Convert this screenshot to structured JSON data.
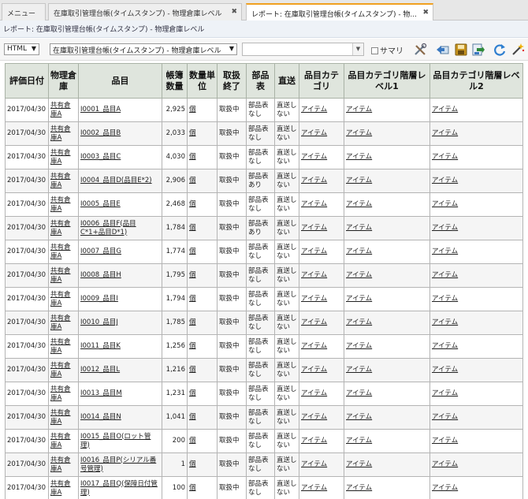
{
  "tabs": [
    {
      "label": "メニュー"
    },
    {
      "label": "在庫取引管理台帳(タイムスタンプ) - 物理倉庫レベル",
      "close": "✖"
    },
    {
      "label": "レポート: 在庫取引管理台帳(タイムスタンプ) - 物...",
      "close": "✖"
    }
  ],
  "breadcrumb": "レポート: 在庫取引管理台帳(タイムスタンプ) - 物理倉庫レベル",
  "toolbar": {
    "format_value": "HTML",
    "report_value": "在庫取引管理台帳(タイムスタンプ) - 物理倉庫レベル",
    "search_value": "",
    "summary_label": "サマリ",
    "icons": [
      "tools-icon",
      "back-icon",
      "save-icon",
      "export-icon",
      "refresh-icon",
      "magic-wand-icon"
    ]
  },
  "table": {
    "headers": [
      "評価日付",
      "物理倉庫",
      "品目",
      "帳簿数量",
      "数量単位",
      "取扱終了",
      "部品表",
      "直送",
      "品目カテゴリ",
      "品目カテゴリ階層レベル1",
      "品目カテゴリ階層レベル2"
    ],
    "rows": [
      {
        "date": "2017/04/30",
        "warehouse": "共有倉庫A",
        "item": "I0001_品目A",
        "qty": "2,925",
        "unit": "個",
        "status": "取扱中",
        "bom": "部品表なし",
        "direct": "直送しない",
        "cat": "アイテム",
        "cat1": "アイテム",
        "cat2": "アイテム"
      },
      {
        "date": "2017/04/30",
        "warehouse": "共有倉庫A",
        "item": "I0002_品目B",
        "qty": "2,033",
        "unit": "個",
        "status": "取扱中",
        "bom": "部品表なし",
        "direct": "直送しない",
        "cat": "アイテム",
        "cat1": "アイテム",
        "cat2": "アイテム"
      },
      {
        "date": "2017/04/30",
        "warehouse": "共有倉庫A",
        "item": "I0003_品目C",
        "qty": "4,030",
        "unit": "個",
        "status": "取扱中",
        "bom": "部品表なし",
        "direct": "直送しない",
        "cat": "アイテム",
        "cat1": "アイテム",
        "cat2": "アイテム"
      },
      {
        "date": "2017/04/30",
        "warehouse": "共有倉庫A",
        "item": "I0004_品目D(品目E*2)",
        "qty": "2,906",
        "unit": "個",
        "status": "取扱中",
        "bom": "部品表あり",
        "direct": "直送しない",
        "cat": "アイテム",
        "cat1": "アイテム",
        "cat2": "アイテム"
      },
      {
        "date": "2017/04/30",
        "warehouse": "共有倉庫A",
        "item": "I0005_品目E",
        "qty": "2,468",
        "unit": "個",
        "status": "取扱中",
        "bom": "部品表なし",
        "direct": "直送しない",
        "cat": "アイテム",
        "cat1": "アイテム",
        "cat2": "アイテム"
      },
      {
        "date": "2017/04/30",
        "warehouse": "共有倉庫A",
        "item": "I0006_品目F(品目C*1+品目D*1)",
        "qty": "1,784",
        "unit": "個",
        "status": "取扱中",
        "bom": "部品表あり",
        "direct": "直送しない",
        "cat": "アイテム",
        "cat1": "アイテム",
        "cat2": "アイテム"
      },
      {
        "date": "2017/04/30",
        "warehouse": "共有倉庫A",
        "item": "I0007_品目G",
        "qty": "1,774",
        "unit": "個",
        "status": "取扱中",
        "bom": "部品表なし",
        "direct": "直送しない",
        "cat": "アイテム",
        "cat1": "アイテム",
        "cat2": "アイテム"
      },
      {
        "date": "2017/04/30",
        "warehouse": "共有倉庫A",
        "item": "I0008_品目H",
        "qty": "1,795",
        "unit": "個",
        "status": "取扱中",
        "bom": "部品表なし",
        "direct": "直送しない",
        "cat": "アイテム",
        "cat1": "アイテム",
        "cat2": "アイテム"
      },
      {
        "date": "2017/04/30",
        "warehouse": "共有倉庫A",
        "item": "I0009_品目I",
        "qty": "1,794",
        "unit": "個",
        "status": "取扱中",
        "bom": "部品表なし",
        "direct": "直送しない",
        "cat": "アイテム",
        "cat1": "アイテム",
        "cat2": "アイテム"
      },
      {
        "date": "2017/04/30",
        "warehouse": "共有倉庫A",
        "item": "I0010_品目J",
        "qty": "1,785",
        "unit": "個",
        "status": "取扱中",
        "bom": "部品表なし",
        "direct": "直送しない",
        "cat": "アイテム",
        "cat1": "アイテム",
        "cat2": "アイテム"
      },
      {
        "date": "2017/04/30",
        "warehouse": "共有倉庫A",
        "item": "I0011_品目K",
        "qty": "1,256",
        "unit": "個",
        "status": "取扱中",
        "bom": "部品表なし",
        "direct": "直送しない",
        "cat": "アイテム",
        "cat1": "アイテム",
        "cat2": "アイテム"
      },
      {
        "date": "2017/04/30",
        "warehouse": "共有倉庫A",
        "item": "I0012_品目L",
        "qty": "1,216",
        "unit": "個",
        "status": "取扱中",
        "bom": "部品表なし",
        "direct": "直送しない",
        "cat": "アイテム",
        "cat1": "アイテム",
        "cat2": "アイテム"
      },
      {
        "date": "2017/04/30",
        "warehouse": "共有倉庫A",
        "item": "I0013_品目M",
        "qty": "1,231",
        "unit": "個",
        "status": "取扱中",
        "bom": "部品表なし",
        "direct": "直送しない",
        "cat": "アイテム",
        "cat1": "アイテム",
        "cat2": "アイテム"
      },
      {
        "date": "2017/04/30",
        "warehouse": "共有倉庫A",
        "item": "I0014_品目N",
        "qty": "1,041",
        "unit": "個",
        "status": "取扱中",
        "bom": "部品表なし",
        "direct": "直送しない",
        "cat": "アイテム",
        "cat1": "アイテム",
        "cat2": "アイテム"
      },
      {
        "date": "2017/04/30",
        "warehouse": "共有倉庫A",
        "item": "I0015_品目O(ロット管理)",
        "qty": "200",
        "unit": "個",
        "status": "取扱中",
        "bom": "部品表なし",
        "direct": "直送しない",
        "cat": "アイテム",
        "cat1": "アイテム",
        "cat2": "アイテム"
      },
      {
        "date": "2017/04/30",
        "warehouse": "共有倉庫A",
        "item": "I0016_品目P(シリアル番号管理)",
        "qty": "1",
        "unit": "個",
        "status": "取扱中",
        "bom": "部品表なし",
        "direct": "直送しない",
        "cat": "アイテム",
        "cat1": "アイテム",
        "cat2": "アイテム"
      },
      {
        "date": "2017/04/30",
        "warehouse": "共有倉庫A",
        "item": "I0017_品目Q(保障日付管理)",
        "qty": "100",
        "unit": "個",
        "status": "取扱中",
        "bom": "部品表なし",
        "direct": "直送しない",
        "cat": "アイテム",
        "cat1": "アイテム",
        "cat2": "アイテム"
      }
    ]
  }
}
